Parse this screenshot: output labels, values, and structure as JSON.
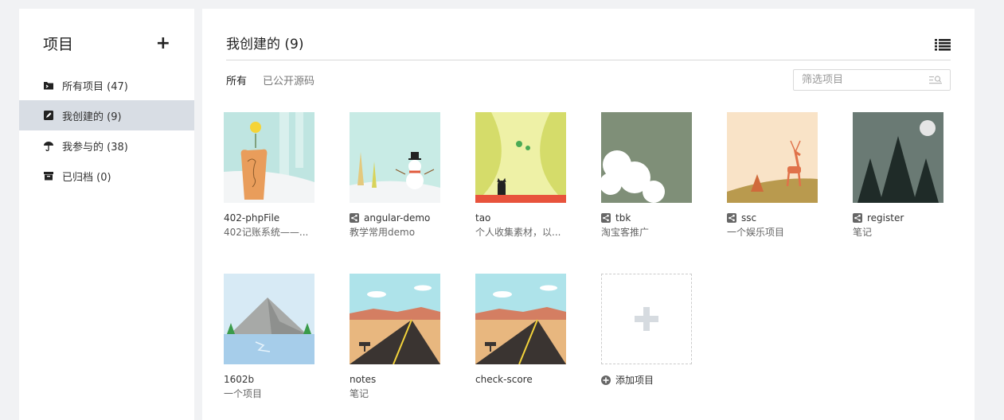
{
  "sidebar": {
    "title": "项目",
    "items": [
      {
        "label": "所有项目 (47)",
        "icon": "folder-icon"
      },
      {
        "label": "我创建的 (9)",
        "icon": "edit-icon"
      },
      {
        "label": "我参与的 (38)",
        "icon": "umbrella-icon"
      },
      {
        "label": "已归档 (0)",
        "icon": "archive-icon"
      }
    ]
  },
  "main": {
    "title": "我创建的 (9)",
    "tabs": [
      "所有",
      "已公开源码"
    ],
    "filter_placeholder": "筛选项目",
    "add_label": "添加项目",
    "projects": [
      {
        "name": "402-phpFile",
        "desc": "402记账系统——...",
        "shared": false
      },
      {
        "name": "angular-demo",
        "desc": "教学常用demo",
        "shared": true
      },
      {
        "name": "tao",
        "desc": "个人收集素材，以...",
        "shared": false
      },
      {
        "name": "tbk",
        "desc": "淘宝客推广",
        "shared": true
      },
      {
        "name": "ssc",
        "desc": "一个娱乐项目",
        "shared": true
      },
      {
        "name": "register",
        "desc": "笔记",
        "shared": true
      },
      {
        "name": "1602b",
        "desc": "一个项目",
        "shared": false
      },
      {
        "name": "notes",
        "desc": "笔记",
        "shared": false
      },
      {
        "name": "check-score",
        "desc": "",
        "shared": false
      }
    ]
  }
}
